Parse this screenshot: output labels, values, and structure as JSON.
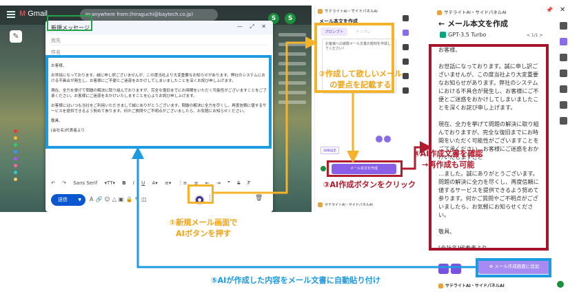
{
  "gmail": {
    "logo_text": "Gmail",
    "search_placeholder": "in:anywhere from:(hiraguchi@baytech.co.jp)",
    "compose": {
      "title": "新規メッセージ",
      "to_label": "宛先",
      "subject_label": "件名",
      "body": [
        "お客様、",
        "お世話になっております。誠に申し訳ございませんが、この度当社より大変重要なお知らせがあります。弊社のシステムにおける不具合が発生し、お客様にご不便とご迷惑をおかけしてしまいましたことを深くお詫び申し上げます。",
        "現在、全力を挙げて問題の解決に取り組んでおりますが、完全な復旧までにお時間をいただく可能性がございますことをご了承ください。お客様にご迷惑をおかけいたしますことを心よりお詫び申し上げます。",
        "お客様にはいつも当社をご利用いただきまして誠にありがとうございます。問題の解決に全力を尽くし、再度信頼に値するサービスを提供できるよう努めて参ります。何かご質問やご不明点がございましたら、お気軽にお知らせください。",
        "敬具、",
        "[会社名]代表者より"
      ],
      "toolbar": {
        "undo": "↶",
        "redo": "↷",
        "font": "Sans Serif",
        "size": "▾TT▾",
        "bold": "B",
        "italic": "I",
        "underline": "U",
        "text_color": "A▾",
        "align": "≡▾",
        "numbered": "⋮≡",
        "bulleted": "≡",
        "indent_less": "⇤",
        "indent_more": "⇥",
        "quote": "❞",
        "strike": "S",
        "clear": "T̸"
      },
      "send_label": "送信",
      "send_arrow": "▼",
      "tool_icons": "A🔗☺△▣🔒✎◫",
      "more_icon": "⋮",
      "trash_icon": "🗑"
    }
  },
  "mid_panel": {
    "header": "サテライトAI・サイドパネルAI",
    "title": "メール本文を作成",
    "tab_active": "プロンプト",
    "tab_inactive": "テンプレ",
    "prompt_text": "お客様への謝罪メール文書の題材を作成してください！",
    "detail_label": "詳細設定",
    "generate_label": "メール本文を作成",
    "footer": "サテライトAI・サイドパネルAI"
  },
  "right_panel": {
    "header": "サテライトAI・サイドパネルAI",
    "pin_icon": "📌",
    "close_icon": "✕",
    "title": "メール本文を作成",
    "back_icon": "←",
    "model": "GPT-3.5 Turbo",
    "page_indicator": "< 1/1 >",
    "text": [
      "お客様、",
      "お世話になっております。誠に申し訳ございませんが、この度当社より大変重要なお知らせがあります。弊社のシステムにおける不具合が発生し、お客様にご不便とご迷惑をおかけしてしまいましたことを深くお詫び申し上げます。",
      "現在、全力を挙げて問題の解決に取り組んでおりますが、完全な復旧までにお時間をいただく可能性がございますことをご了承ください。お客様にご迷惑をおかけいたしますこと",
      "…ました。誠にありがとうございます。問題の解決に全力を尽くし、再度信頼に値するサービスを提供できるよう努めて参ります。何かご質問やご不明点がございましたら、お気軽にお知らせください。",
      "敬具、",
      "[会社名]代表者より"
    ],
    "add_label": "メール作成画面に追加",
    "add_icon": "⊕",
    "footer": "サテライトAI・サイドパネルAI"
  },
  "annotations": {
    "step1_line1": "①新規メール画面で",
    "step1_line2": "AIボタンを押す",
    "step2_line1": "②作成して欲しいメール",
    "step2_line2": "の要点を記載する",
    "step3": "③AI作成ボタンをクリック",
    "step4_line1": "④AI作成文書を確認",
    "step4_line2": "→再作成も可能",
    "step5": "⑤AIが作成した内容をメール文書に自動貼り付け"
  },
  "colors": {
    "orange": "#f4b32a",
    "blue": "#1c9be0",
    "red": "#b01c2e",
    "green": "#21a34a",
    "purple": "#8a5fe8"
  }
}
